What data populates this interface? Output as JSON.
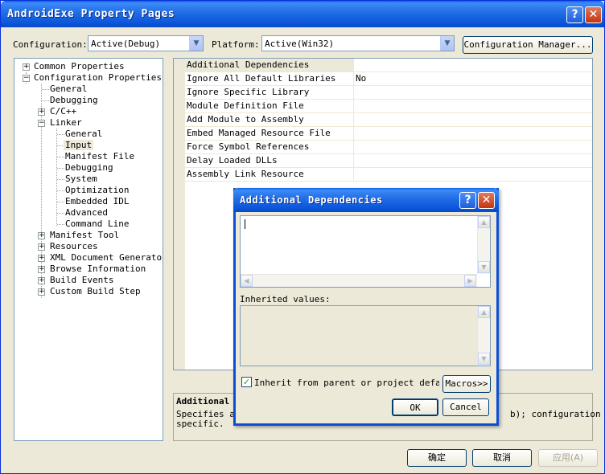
{
  "window": {
    "title": "AndroidExe Property Pages",
    "help_glyph": "?",
    "close_glyph": "✕"
  },
  "config": {
    "configuration_label": "Configuration:",
    "configuration_value": "Active(Debug)",
    "platform_label": "Platform:",
    "platform_value": "Active(Win32)",
    "manager_button": "Configuration Manager..."
  },
  "tree": {
    "common": "Common Properties",
    "config_props": "Configuration Properties",
    "general": "General",
    "debugging": "Debugging",
    "cpp": "C/C++",
    "linker": "Linker",
    "linker_general": "General",
    "linker_input": "Input",
    "linker_manifest": "Manifest File",
    "linker_debugging": "Debugging",
    "linker_system": "System",
    "linker_optimization": "Optimization",
    "linker_embedded_idl": "Embedded IDL",
    "linker_advanced": "Advanced",
    "linker_command_line": "Command Line",
    "manifest_tool": "Manifest Tool",
    "resources": "Resources",
    "xml_doc": "XML Document Generator",
    "browse_info": "Browse Information",
    "build_events": "Build Events",
    "custom_build": "Custom Build Step"
  },
  "grid": {
    "rows": [
      {
        "name": "Additional Dependencies",
        "value": ""
      },
      {
        "name": "Ignore All Default Libraries",
        "value": "No"
      },
      {
        "name": "Ignore Specific Library",
        "value": ""
      },
      {
        "name": "Module Definition File",
        "value": ""
      },
      {
        "name": "Add Module to Assembly",
        "value": ""
      },
      {
        "name": "Embed Managed Resource File",
        "value": ""
      },
      {
        "name": "Force Symbol References",
        "value": ""
      },
      {
        "name": "Delay Loaded DLLs",
        "value": ""
      },
      {
        "name": "Assembly Link Resource",
        "value": ""
      }
    ]
  },
  "description": {
    "title": "Additional",
    "line1": "Specifies ad",
    "line2": "specific.",
    "line1_right": "b); configuration"
  },
  "buttons": {
    "ok": "确定",
    "cancel": "取消",
    "apply": "应用(A)"
  },
  "dialog": {
    "title": "Additional Dependencies",
    "help_glyph": "?",
    "close_glyph": "✕",
    "inherited_label": "Inherited values:",
    "inherit_checkbox": "Inherit from parent or project defaults",
    "macros_button": "Macros>>",
    "ok": "OK",
    "cancel": "Cancel",
    "check_glyph": "✓"
  }
}
